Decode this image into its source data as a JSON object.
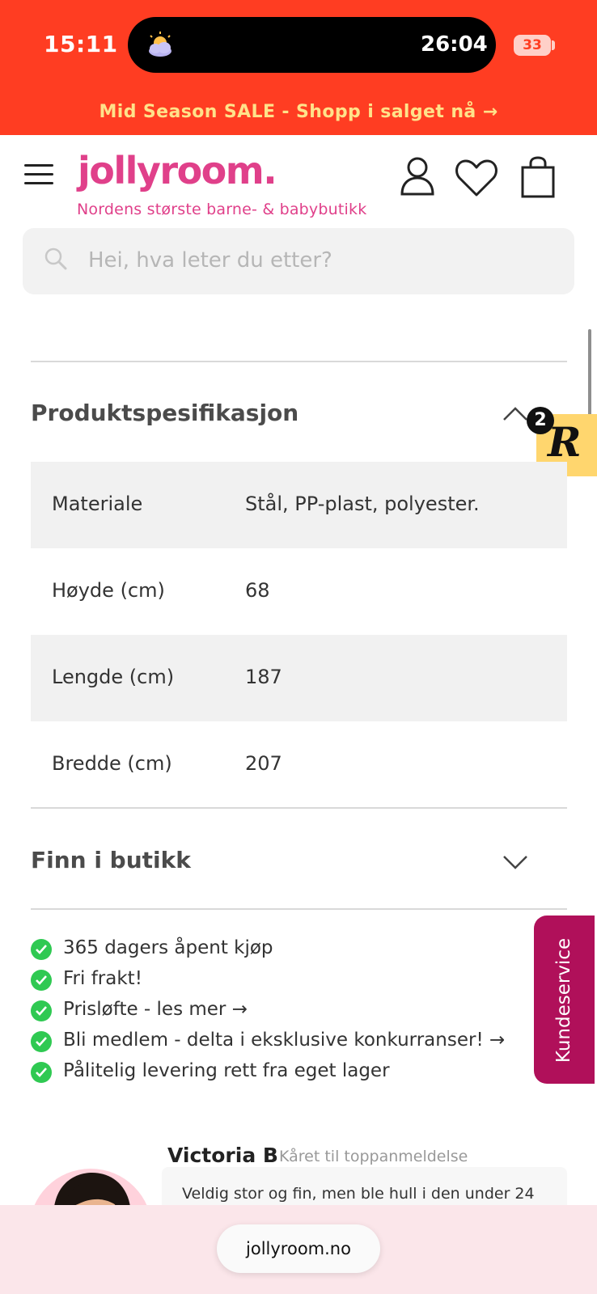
{
  "status_bar": {
    "time": "15:11",
    "timer": "26:04",
    "battery": "33"
  },
  "promo": {
    "text": "Mid Season SALE - Shopp i salget nå →"
  },
  "header": {
    "logo": "jollyroom.",
    "tagline": "Nordens største barne- & babybutikk"
  },
  "search": {
    "placeholder": "Hei, hva leter du etter?"
  },
  "spec": {
    "title": "Produktspesifikasjon",
    "rows": [
      {
        "label": "Materiale",
        "value": "Stål, PP-plast, polyester."
      },
      {
        "label": "Høyde (cm)",
        "value": "68"
      },
      {
        "label": "Lengde (cm)",
        "value": "187"
      },
      {
        "label": "Bredde (cm)",
        "value": "207"
      }
    ]
  },
  "store": {
    "title": "Finn i butikk"
  },
  "reviews_badge": {
    "count": "2",
    "letter": "R"
  },
  "usps": [
    "365 dagers åpent kjøp",
    "Fri frakt!",
    "Prisløfte - les mer →",
    "Bli medlem - delta i eksklusive konkurranser! →",
    "Pålitelig levering rett fra eget lager"
  ],
  "customer_service": {
    "label": "Kundeservice"
  },
  "review": {
    "name": "Victoria B",
    "tag": "Kåret til toppanmeldelse",
    "text": "Veldig stor og fin, men ble hull i den under 24"
  },
  "browser": {
    "url": "jollyroom.no"
  },
  "colors": {
    "brand_pink": "#e0408a",
    "promo_red": "#ff3d22",
    "service_magenta": "#b0105a",
    "check_green": "#2fc952"
  }
}
